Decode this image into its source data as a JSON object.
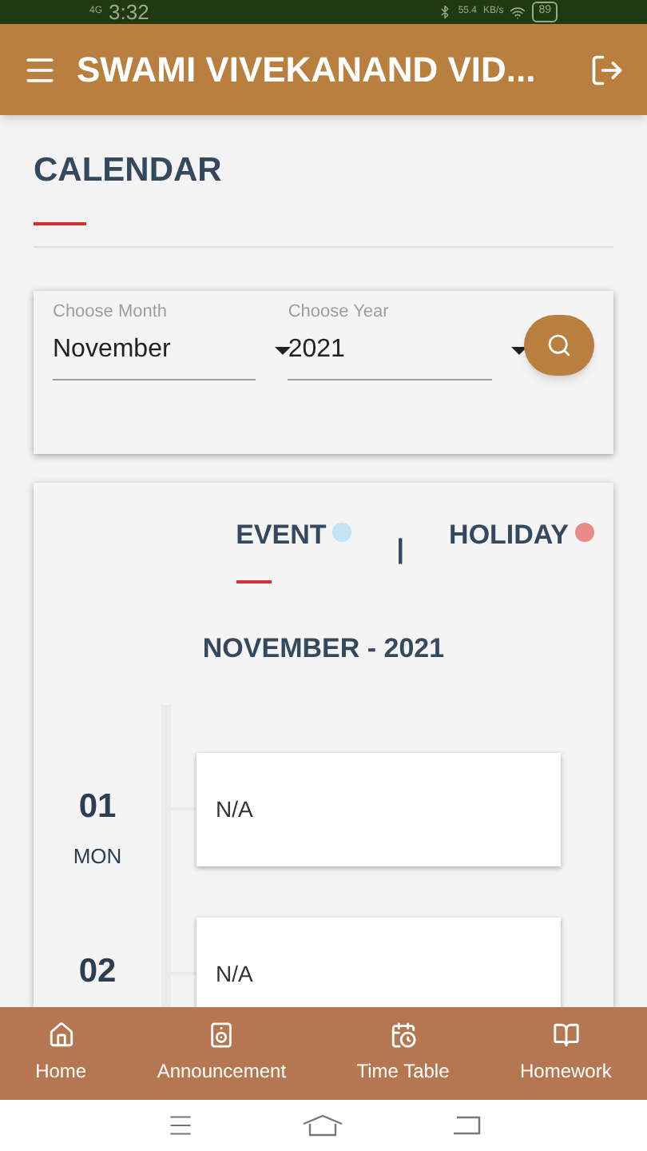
{
  "status_bar": {
    "network": "4G",
    "time": "3:32",
    "speed": "55.4",
    "speed_unit": "KB/s",
    "battery": "89"
  },
  "app_bar": {
    "title": "SWAMI VIVEKANAND VID..."
  },
  "page": {
    "heading": "CALENDAR"
  },
  "filters": [
    {
      "label": "Choose Month",
      "value": "November"
    },
    {
      "label": "Choose Year",
      "value": "2021"
    }
  ],
  "legend": [
    {
      "label": "EVENT",
      "color": "#c6e2f7",
      "selected": true
    },
    {
      "label": "HOLIDAY",
      "color": "#e88a88",
      "selected": false
    }
  ],
  "legend_separator": "|",
  "month_title": "NOVEMBER - 2021",
  "days": [
    {
      "day": "01",
      "weekday": "MON",
      "text": "N/A"
    },
    {
      "day": "02",
      "text": "N/A"
    }
  ],
  "bottom_nav": [
    {
      "label": "Home"
    },
    {
      "label": "Announcement"
    },
    {
      "label": "Time Table"
    },
    {
      "label": "Homework"
    }
  ]
}
